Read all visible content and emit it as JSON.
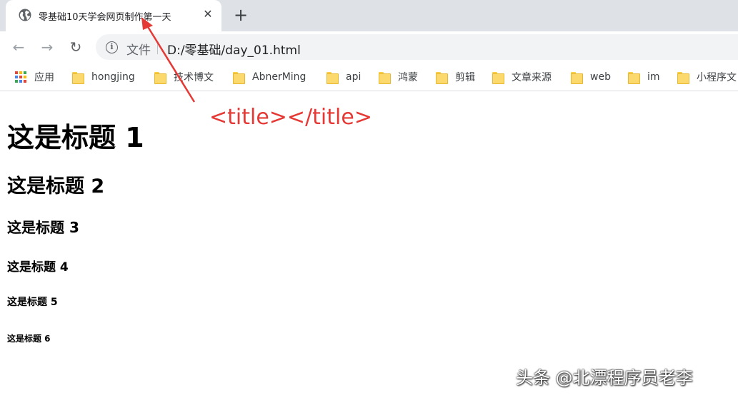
{
  "tab": {
    "title": "零基础10天学会网页制作第一天",
    "close_glyph": "✕",
    "favicon": "globe-icon"
  },
  "new_tab_glyph": "+",
  "toolbar": {
    "back_glyph": "←",
    "forward_glyph": "→",
    "reload_glyph": "↻",
    "info_glyph": "i",
    "omnibox_label": "文件",
    "url": "D:/零基础/day_01.html"
  },
  "bookmarks": [
    {
      "label": "应用",
      "icon": "apps-grid-icon"
    },
    {
      "label": "hongjing",
      "icon": "folder-icon"
    },
    {
      "label": "技术博文",
      "icon": "folder-icon"
    },
    {
      "label": "AbnerMing",
      "icon": "folder-icon"
    },
    {
      "label": "api",
      "icon": "folder-icon"
    },
    {
      "label": "鸿蒙",
      "icon": "folder-icon"
    },
    {
      "label": "剪辑",
      "icon": "folder-icon"
    },
    {
      "label": "文章来源",
      "icon": "folder-icon"
    },
    {
      "label": "web",
      "icon": "folder-icon"
    },
    {
      "label": "im",
      "icon": "folder-icon"
    },
    {
      "label": "小程序文",
      "icon": "folder-icon"
    }
  ],
  "headings": {
    "h1": "这是标题 1",
    "h2": "这是标题 2",
    "h3": "这是标题 3",
    "h4": "这是标题 4",
    "h5": "这是标题 5",
    "h6": "这是标题 6"
  },
  "annotation": {
    "text": "<title></title>",
    "color": "#e53935"
  },
  "watermark": "头条 @北漂程序员老李"
}
